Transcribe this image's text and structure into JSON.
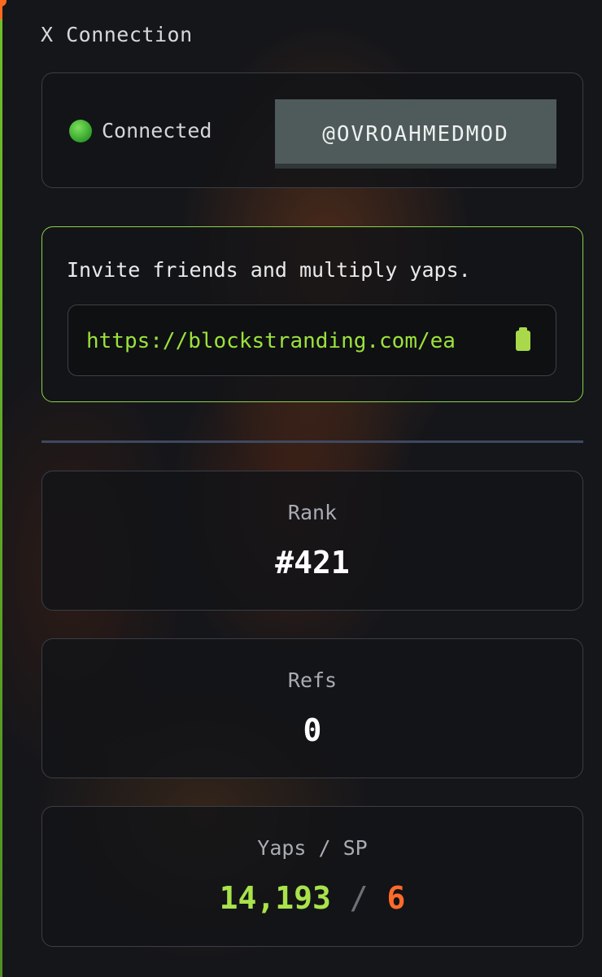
{
  "section": {
    "title": "X Connection"
  },
  "connection": {
    "status_text": "Connected",
    "handle": "@OVROAHMEDMOD"
  },
  "invite": {
    "text": "Invite friends and multiply yaps.",
    "link": "https://blockstranding.com/ea"
  },
  "stats": {
    "rank": {
      "label": "Rank",
      "value": "#421"
    },
    "refs": {
      "label": "Refs",
      "value": "0"
    },
    "yaps_sp": {
      "label": "Yaps / SP",
      "yaps": "14,193",
      "separator": "/",
      "sp": "6"
    }
  },
  "colors": {
    "accent_green": "#a9e34b",
    "accent_orange": "#ff6a2a",
    "status_green": "#2fa02a"
  },
  "icons": {
    "status": "green-circle-icon",
    "copy": "clipboard-icon"
  }
}
